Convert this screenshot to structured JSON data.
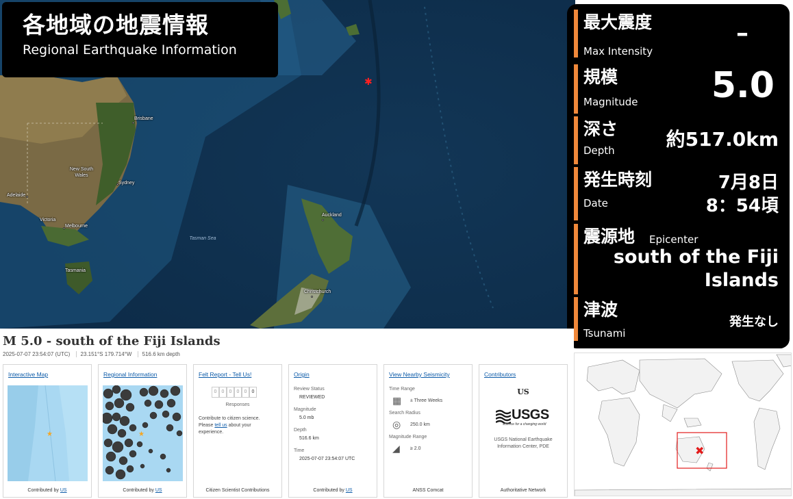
{
  "title": {
    "jp": "各地域の地震情報",
    "en": "Regional Earthquake Information"
  },
  "info": {
    "intensity": {
      "jp": "最大震度",
      "en": "Max  Intensity",
      "value": "–"
    },
    "magnitude": {
      "jp": "規模",
      "en": "Magnitude",
      "value": "5.0"
    },
    "depth": {
      "jp": "深さ",
      "en": "Depth",
      "value": "約517.0km"
    },
    "date": {
      "jp": "発生時刻",
      "en": "Date",
      "value_line1": "7月8日",
      "value_line2": "8：54頃"
    },
    "epicenter": {
      "jp": "震源地",
      "en": "Epicenter",
      "value_line1": "south of the Fiji",
      "value_line2": "Islands"
    },
    "tsunami": {
      "jp": "津波",
      "en": "Tsunami",
      "value": "発生なし"
    }
  },
  "map": {
    "cities": [
      "Brisbane",
      "New South Wales",
      "Sydney",
      "Adelaide",
      "Victoria",
      "Melbourne",
      "Tasmania",
      "Auckland",
      "Christchurch"
    ],
    "sea": "Tasman Sea"
  },
  "usgs": {
    "event_title": "M 5.0 - south of the Fiji Islands",
    "meta": [
      "2025-07-07 23:54:07 (UTC)",
      "23.151°S 179.714°W",
      "516.6 km depth"
    ],
    "cards": {
      "map": {
        "head": "Interactive Map",
        "foot_prefix": "Contributed by ",
        "foot_link": "US"
      },
      "region": {
        "head": "Regional Information",
        "foot_prefix": "Contributed by ",
        "foot_link": "US"
      },
      "felt": {
        "head": "Felt Report - Tell Us!",
        "counter": [
          "0",
          "0",
          "0",
          "0",
          "0",
          "0"
        ],
        "responses": "Responses",
        "text_1": "Contribute to citizen science.",
        "text_2": "Please ",
        "text_link": "tell us",
        "text_3": " about your",
        "text_4": "experience.",
        "foot": "Citizen Scientist Contributions"
      },
      "origin": {
        "head": "Origin",
        "review_label": "Review Status",
        "review_value": "REVIEWED",
        "mag_label": "Magnitude",
        "mag_value": "5.0 mb",
        "depth_label": "Depth",
        "depth_value": "516.6 km",
        "time_label": "Time",
        "time_value": "2025-07-07 23:54:07 UTC",
        "foot_prefix": "Contributed by ",
        "foot_link": "US"
      },
      "nearby": {
        "head": "View Nearby Seismicity",
        "range_label": "Time Range",
        "range_value": "± Three Weeks",
        "radius_label": "Search Radius",
        "radius_value": "250.0 km",
        "mag_label": "Magnitude Range",
        "mag_value": "≥ 2.0",
        "foot": "ANSS Comcat"
      },
      "contrib": {
        "head": "Contributors",
        "code": "US",
        "logo": "USGS",
        "logo_tag": "science for a changing world",
        "name_1": "USGS National Earthquake",
        "name_2": "Information Center, PDE",
        "foot": "Authoritative Network"
      }
    }
  },
  "colors": {
    "accent": "#f0883a",
    "epicenter": "#ff2020",
    "link": "#0b5aa8"
  }
}
